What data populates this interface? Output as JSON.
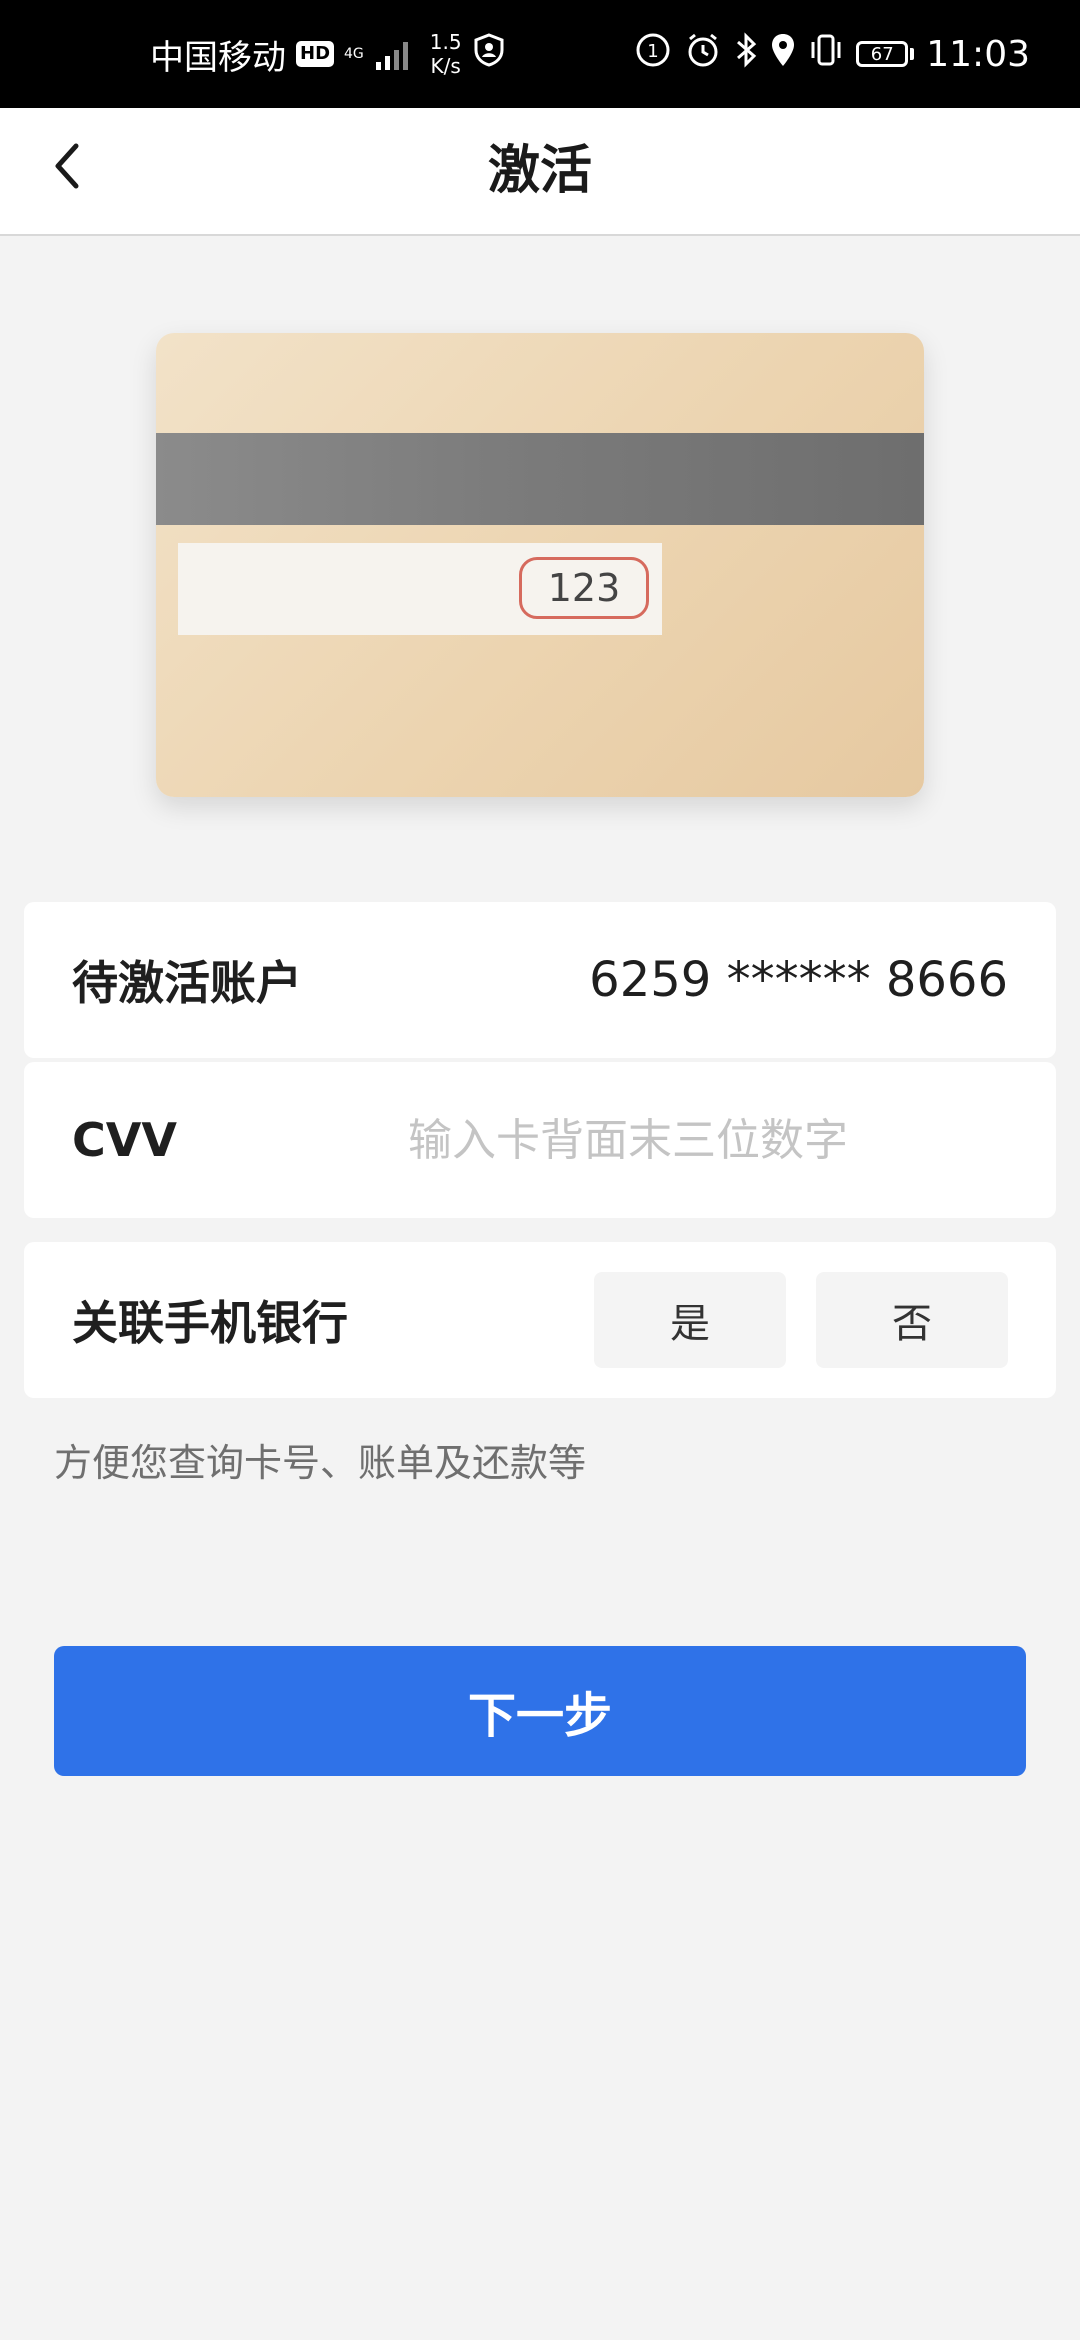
{
  "status_bar": {
    "carrier": "中国移动",
    "hd": "HD",
    "network": "4G",
    "speed_value": "1.5",
    "speed_unit": "K/s",
    "battery": "67",
    "time": "11:03"
  },
  "header": {
    "title": "激活"
  },
  "card_illustration": {
    "cvv_sample": "123"
  },
  "form": {
    "account_label": "待激活账户",
    "account_value": "6259 ****** 8666",
    "cvv_label": "CVV",
    "cvv_value": "",
    "cvv_placeholder": "输入卡背面末三位数字",
    "link_label": "关联手机银行",
    "link_yes": "是",
    "link_no": "否",
    "hint": "方便您查询卡号、账单及还款等"
  },
  "actions": {
    "next_label": "下一步"
  },
  "colors": {
    "primary": "#2f72e8",
    "cvv_highlight": "#d66a5d"
  }
}
